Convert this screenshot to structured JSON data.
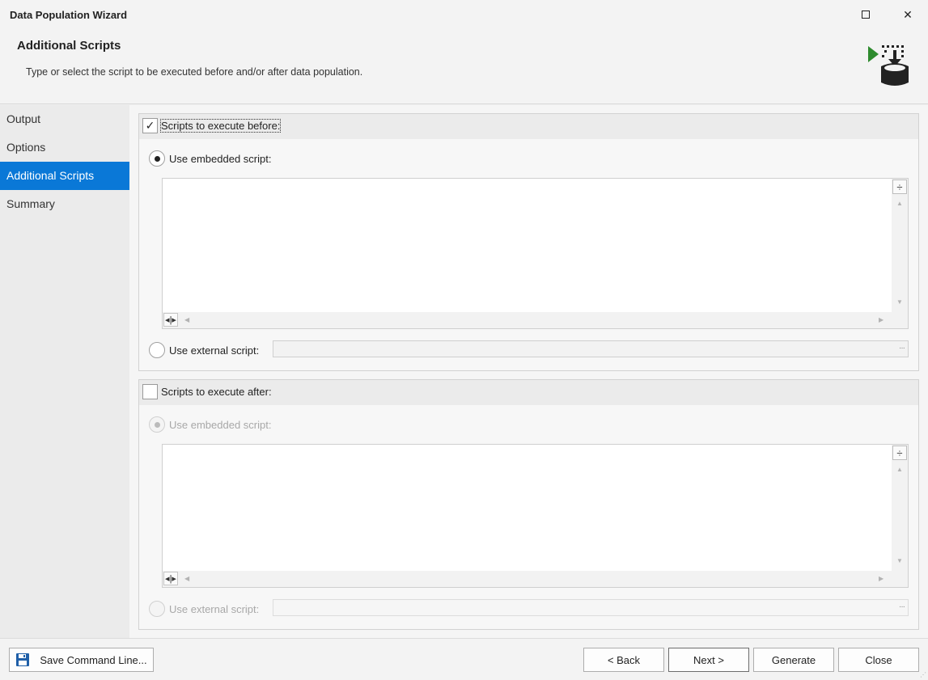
{
  "window": {
    "title": "Data Population Wizard",
    "maximize_icon": "maximize-icon",
    "close_glyph": "✕"
  },
  "header": {
    "title": "Additional Scripts",
    "description": "Type or select the script to be executed before and/or after data population.",
    "logo_icon": "data-population-icon",
    "logo_colors": {
      "arrow": "#2e8b2e",
      "database": "#222222"
    }
  },
  "sidebar": {
    "items": [
      {
        "label": "Output",
        "active": false
      },
      {
        "label": "Options",
        "active": false
      },
      {
        "label": "Additional Scripts",
        "active": true
      },
      {
        "label": "Summary",
        "active": false
      }
    ],
    "active_color": "#0a78d7"
  },
  "before_group": {
    "checked": true,
    "check_glyph": "✓",
    "label": "Scripts to execute before:",
    "embedded_label": "Use embedded script:",
    "embedded_selected": true,
    "script_text": "",
    "external_label": "Use external script:",
    "external_selected": false,
    "external_value": "",
    "browse_glyph": "···"
  },
  "after_group": {
    "checked": false,
    "check_glyph": "",
    "label": "Scripts to execute after:",
    "embedded_label": "Use embedded script:",
    "embedded_selected": true,
    "script_text": "",
    "external_label": "Use external script:",
    "external_selected": false,
    "external_value": "",
    "browse_glyph": "···"
  },
  "footer": {
    "save_label": "Save Command Line...",
    "save_icon": "floppy-disk-icon",
    "back_label": "< Back",
    "next_label": "Next >",
    "generate_label": "Generate",
    "close_label": "Close"
  }
}
